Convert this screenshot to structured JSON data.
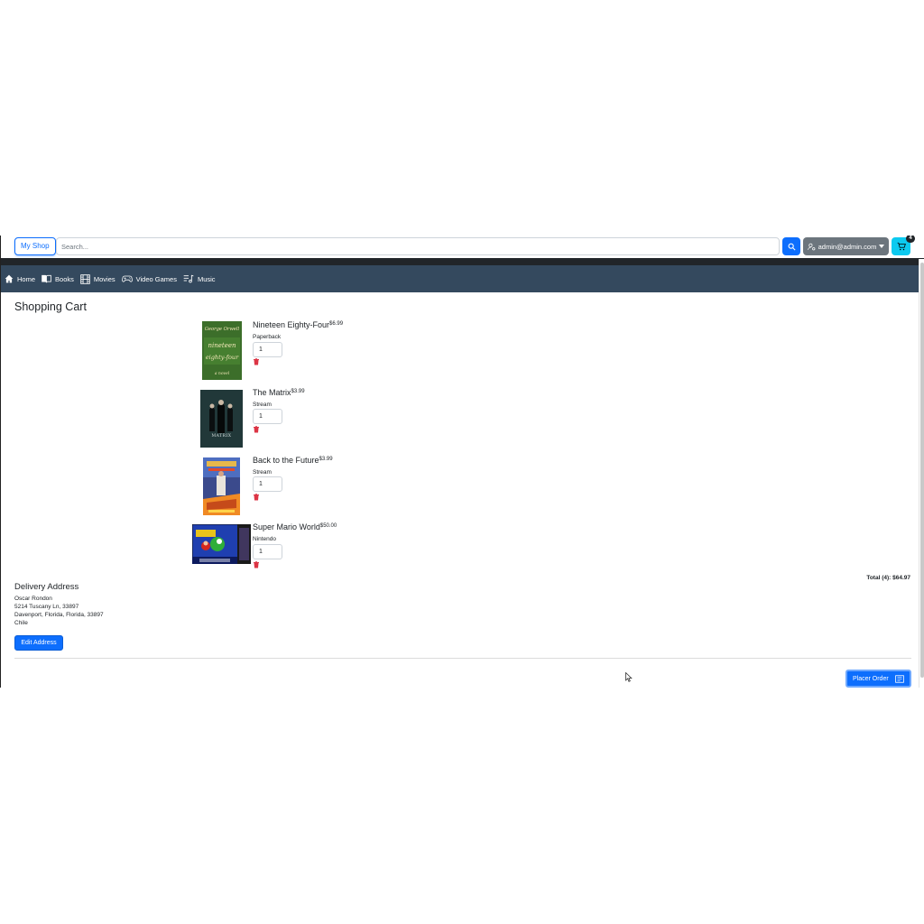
{
  "header": {
    "brand": "My Shop",
    "search_placeholder": "Search...",
    "user_label": "admin@admin.com",
    "cart_count": "4"
  },
  "nav": {
    "items": [
      {
        "label": "Home",
        "icon": "home-icon"
      },
      {
        "label": "Books",
        "icon": "book-icon"
      },
      {
        "label": "Movies",
        "icon": "film-icon"
      },
      {
        "label": "Video Games",
        "icon": "gamepad-icon"
      },
      {
        "label": "Music",
        "icon": "music-icon"
      }
    ]
  },
  "cart": {
    "title": "Shopping Cart",
    "items": [
      {
        "name": "Nineteen Eighty-Four",
        "price": "$6.99",
        "format": "Paperback",
        "quantity": "1",
        "cover_text": [
          "George Orwell",
          "nineteen",
          "eighty-four",
          "a novel"
        ]
      },
      {
        "name": "The Matrix",
        "price": "$3.99",
        "format": "Stream",
        "quantity": "1",
        "cover_text": [
          "MATRIX"
        ]
      },
      {
        "name": "Back to the Future",
        "price": "$3.99",
        "format": "Stream",
        "quantity": "1",
        "cover_text": []
      },
      {
        "name": "Super Mario World",
        "price": "$50.00",
        "format": "Nintendo",
        "quantity": "1",
        "cover_text": []
      }
    ],
    "total": "Total (4): $64.97"
  },
  "delivery": {
    "title": "Delivery Address",
    "lines": [
      "Oscar Rondon",
      "5214 Tuscany Ln, 33897",
      "Davenport, Florida, Florida, 33897",
      "Chile"
    ],
    "edit_label": "Edit Address"
  },
  "order": {
    "place_label": "Placer Order"
  },
  "colors": {
    "primary": "#0d6efd",
    "navbar": "#34495e",
    "nav_dark": "#212529",
    "cart_button": "#0dcaf0",
    "user_button": "#6c757d",
    "trash": "#dc3545"
  }
}
